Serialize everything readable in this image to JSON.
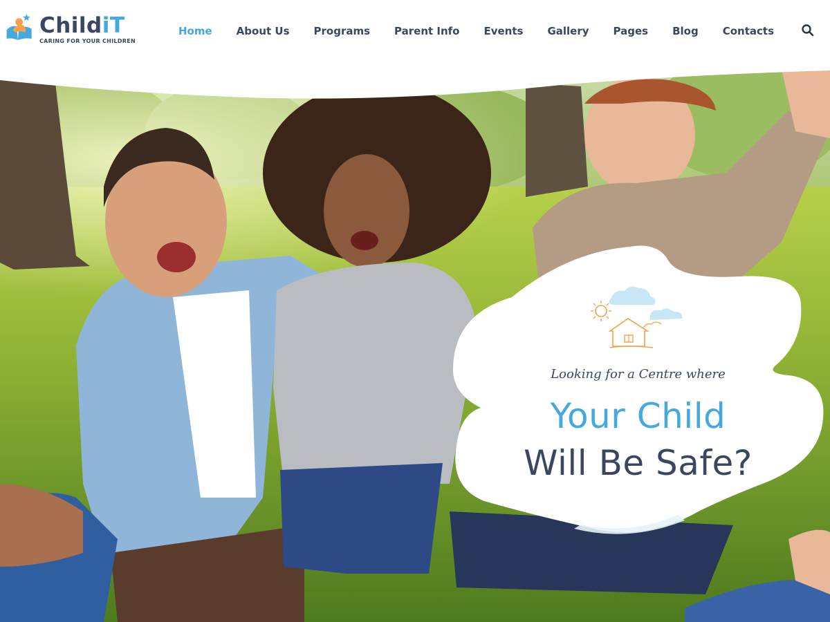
{
  "brand": {
    "name_part1": "Child",
    "name_part2": "iT",
    "tagline": "CARING FOR YOUR CHILDREN"
  },
  "nav": {
    "items": [
      {
        "label": "Home",
        "active": true
      },
      {
        "label": "About Us",
        "active": false
      },
      {
        "label": "Programs",
        "active": false
      },
      {
        "label": "Parent Info",
        "active": false
      },
      {
        "label": "Events",
        "active": false
      },
      {
        "label": "Gallery",
        "active": false
      },
      {
        "label": "Pages",
        "active": false
      },
      {
        "label": "Blog",
        "active": false
      },
      {
        "label": "Contacts",
        "active": false
      }
    ],
    "search_icon": "search-icon"
  },
  "hero": {
    "kicker": "Looking for a Centre where",
    "headline_line1": "Your Child",
    "headline_line2": "Will Be Safe?"
  },
  "colors": {
    "accent": "#45a9dd",
    "dark": "#3b4660",
    "logo_orange": "#f5a04a"
  }
}
